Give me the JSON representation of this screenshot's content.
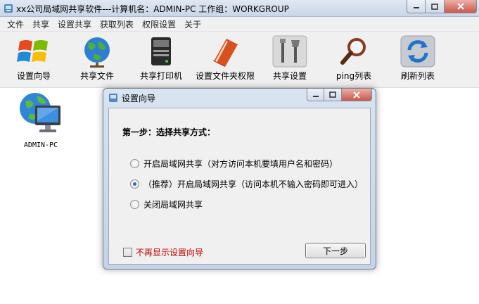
{
  "window": {
    "title": "xx公司局域网共享软件---计算机名：ADMIN-PC   工作组：WORKGROUP",
    "controls": [
      "minimize-icon",
      "maximize-icon",
      "close-icon"
    ]
  },
  "menu": [
    "文件",
    "共享",
    "设置共享",
    "获取列表",
    "权限设置",
    "关于"
  ],
  "toolbar": [
    {
      "label": "设置向导",
      "icon": "windows-logo-icon"
    },
    {
      "label": "共享文件",
      "icon": "globe-icon"
    },
    {
      "label": "共享打印机",
      "icon": "printer-icon"
    },
    {
      "label": "设置文件夹权限",
      "icon": "book-icon"
    },
    {
      "label": "共享设置",
      "icon": "tools-icon"
    },
    {
      "label": "ping列表",
      "icon": "magnifier-icon"
    },
    {
      "label": "刷新列表",
      "icon": "refresh-icon"
    }
  ],
  "computers": [
    {
      "name": "ADMIN-PC",
      "icon": "network-computer-icon"
    }
  ],
  "dialog": {
    "title": "设置向导",
    "step_title": "第一步：选择共享方式：",
    "options": [
      {
        "label": "开启局域网共享（对方访问本机要填用户名和密码）",
        "selected": false
      },
      {
        "label": "（推荐）开启局域网共享（访问本机不输入密码即可进入）",
        "selected": true
      },
      {
        "label": "关闭局域网共享",
        "selected": false
      }
    ],
    "dont_show_label": "不再显示设置向导",
    "dont_show_checked": false,
    "next_label": "下一步"
  },
  "colors": {
    "warning_text": "#c00000",
    "radio_selected": "#2f6fbf"
  }
}
